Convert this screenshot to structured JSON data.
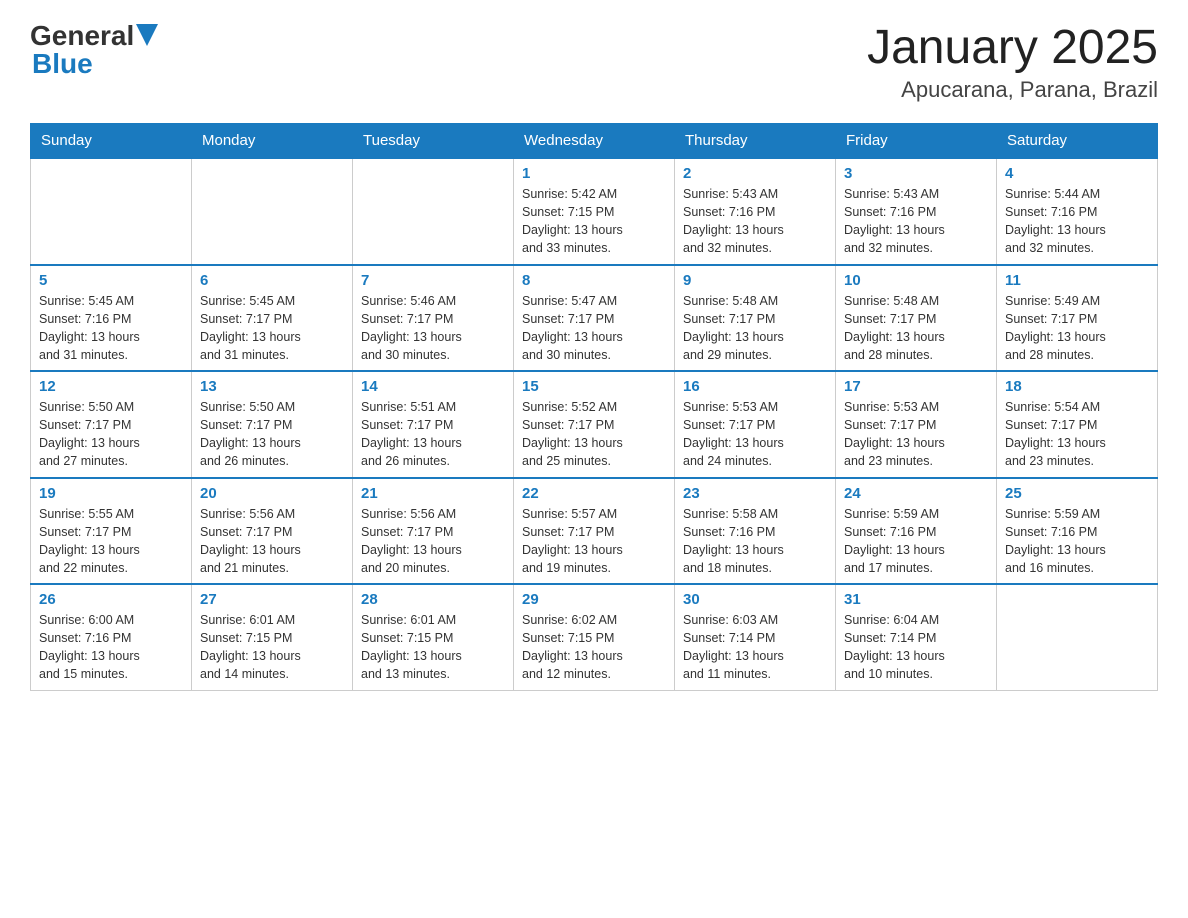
{
  "header": {
    "logo_general": "General",
    "logo_blue": "Blue",
    "title": "January 2025",
    "subtitle": "Apucarana, Parana, Brazil"
  },
  "weekdays": [
    "Sunday",
    "Monday",
    "Tuesday",
    "Wednesday",
    "Thursday",
    "Friday",
    "Saturday"
  ],
  "weeks": [
    [
      {
        "day": "",
        "info": ""
      },
      {
        "day": "",
        "info": ""
      },
      {
        "day": "",
        "info": ""
      },
      {
        "day": "1",
        "info": "Sunrise: 5:42 AM\nSunset: 7:15 PM\nDaylight: 13 hours\nand 33 minutes."
      },
      {
        "day": "2",
        "info": "Sunrise: 5:43 AM\nSunset: 7:16 PM\nDaylight: 13 hours\nand 32 minutes."
      },
      {
        "day": "3",
        "info": "Sunrise: 5:43 AM\nSunset: 7:16 PM\nDaylight: 13 hours\nand 32 minutes."
      },
      {
        "day": "4",
        "info": "Sunrise: 5:44 AM\nSunset: 7:16 PM\nDaylight: 13 hours\nand 32 minutes."
      }
    ],
    [
      {
        "day": "5",
        "info": "Sunrise: 5:45 AM\nSunset: 7:16 PM\nDaylight: 13 hours\nand 31 minutes."
      },
      {
        "day": "6",
        "info": "Sunrise: 5:45 AM\nSunset: 7:17 PM\nDaylight: 13 hours\nand 31 minutes."
      },
      {
        "day": "7",
        "info": "Sunrise: 5:46 AM\nSunset: 7:17 PM\nDaylight: 13 hours\nand 30 minutes."
      },
      {
        "day": "8",
        "info": "Sunrise: 5:47 AM\nSunset: 7:17 PM\nDaylight: 13 hours\nand 30 minutes."
      },
      {
        "day": "9",
        "info": "Sunrise: 5:48 AM\nSunset: 7:17 PM\nDaylight: 13 hours\nand 29 minutes."
      },
      {
        "day": "10",
        "info": "Sunrise: 5:48 AM\nSunset: 7:17 PM\nDaylight: 13 hours\nand 28 minutes."
      },
      {
        "day": "11",
        "info": "Sunrise: 5:49 AM\nSunset: 7:17 PM\nDaylight: 13 hours\nand 28 minutes."
      }
    ],
    [
      {
        "day": "12",
        "info": "Sunrise: 5:50 AM\nSunset: 7:17 PM\nDaylight: 13 hours\nand 27 minutes."
      },
      {
        "day": "13",
        "info": "Sunrise: 5:50 AM\nSunset: 7:17 PM\nDaylight: 13 hours\nand 26 minutes."
      },
      {
        "day": "14",
        "info": "Sunrise: 5:51 AM\nSunset: 7:17 PM\nDaylight: 13 hours\nand 26 minutes."
      },
      {
        "day": "15",
        "info": "Sunrise: 5:52 AM\nSunset: 7:17 PM\nDaylight: 13 hours\nand 25 minutes."
      },
      {
        "day": "16",
        "info": "Sunrise: 5:53 AM\nSunset: 7:17 PM\nDaylight: 13 hours\nand 24 minutes."
      },
      {
        "day": "17",
        "info": "Sunrise: 5:53 AM\nSunset: 7:17 PM\nDaylight: 13 hours\nand 23 minutes."
      },
      {
        "day": "18",
        "info": "Sunrise: 5:54 AM\nSunset: 7:17 PM\nDaylight: 13 hours\nand 23 minutes."
      }
    ],
    [
      {
        "day": "19",
        "info": "Sunrise: 5:55 AM\nSunset: 7:17 PM\nDaylight: 13 hours\nand 22 minutes."
      },
      {
        "day": "20",
        "info": "Sunrise: 5:56 AM\nSunset: 7:17 PM\nDaylight: 13 hours\nand 21 minutes."
      },
      {
        "day": "21",
        "info": "Sunrise: 5:56 AM\nSunset: 7:17 PM\nDaylight: 13 hours\nand 20 minutes."
      },
      {
        "day": "22",
        "info": "Sunrise: 5:57 AM\nSunset: 7:17 PM\nDaylight: 13 hours\nand 19 minutes."
      },
      {
        "day": "23",
        "info": "Sunrise: 5:58 AM\nSunset: 7:16 PM\nDaylight: 13 hours\nand 18 minutes."
      },
      {
        "day": "24",
        "info": "Sunrise: 5:59 AM\nSunset: 7:16 PM\nDaylight: 13 hours\nand 17 minutes."
      },
      {
        "day": "25",
        "info": "Sunrise: 5:59 AM\nSunset: 7:16 PM\nDaylight: 13 hours\nand 16 minutes."
      }
    ],
    [
      {
        "day": "26",
        "info": "Sunrise: 6:00 AM\nSunset: 7:16 PM\nDaylight: 13 hours\nand 15 minutes."
      },
      {
        "day": "27",
        "info": "Sunrise: 6:01 AM\nSunset: 7:15 PM\nDaylight: 13 hours\nand 14 minutes."
      },
      {
        "day": "28",
        "info": "Sunrise: 6:01 AM\nSunset: 7:15 PM\nDaylight: 13 hours\nand 13 minutes."
      },
      {
        "day": "29",
        "info": "Sunrise: 6:02 AM\nSunset: 7:15 PM\nDaylight: 13 hours\nand 12 minutes."
      },
      {
        "day": "30",
        "info": "Sunrise: 6:03 AM\nSunset: 7:14 PM\nDaylight: 13 hours\nand 11 minutes."
      },
      {
        "day": "31",
        "info": "Sunrise: 6:04 AM\nSunset: 7:14 PM\nDaylight: 13 hours\nand 10 minutes."
      },
      {
        "day": "",
        "info": ""
      }
    ]
  ]
}
